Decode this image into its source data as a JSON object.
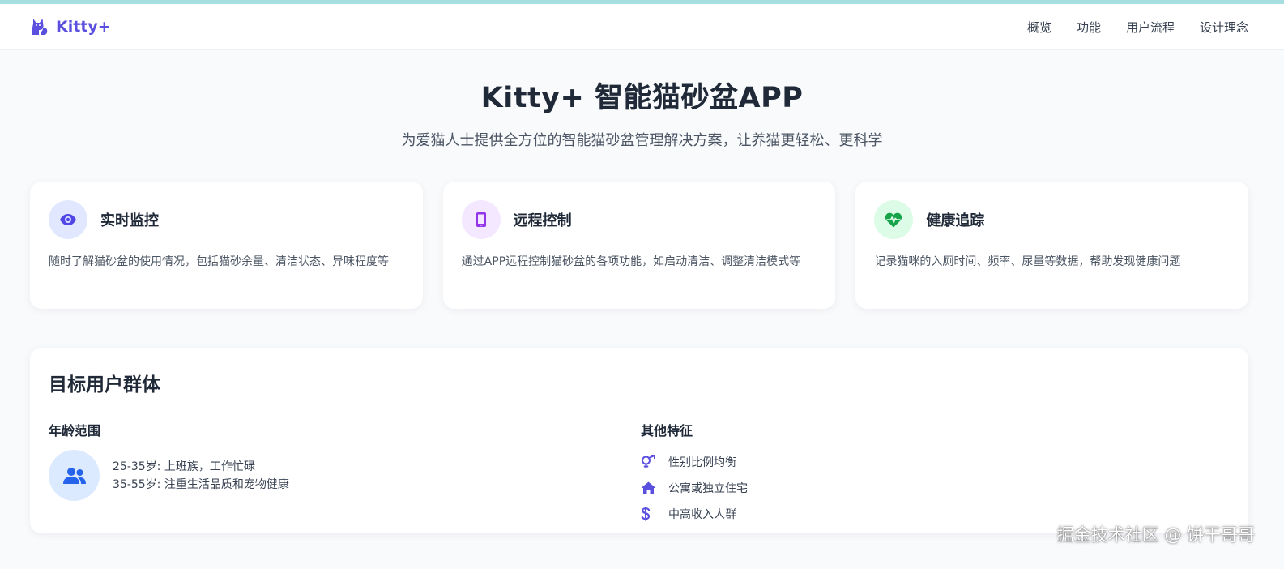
{
  "brand": {
    "name": "Kitty+",
    "logo_icon": "cat-icon",
    "accent": "#5b4fe0"
  },
  "nav": {
    "items": [
      "概览",
      "功能",
      "用户流程",
      "设计理念"
    ]
  },
  "hero": {
    "title": "Kitty+ 智能猫砂盆APP",
    "subtitle": "为爱猫人士提供全方位的智能猫砂盆管理解决方案，让养猫更轻松、更科学"
  },
  "features": [
    {
      "icon": "eye-icon",
      "title": "实时监控",
      "desc": "随时了解猫砂盆的使用情况，包括猫砂余量、清洁状态、异味程度等",
      "color": "#4f46e5"
    },
    {
      "icon": "mobile-icon",
      "title": "远程控制",
      "desc": "通过APP远程控制猫砂盆的各项功能，如启动清洁、调整清洁模式等",
      "color": "#9333ea"
    },
    {
      "icon": "heartbeat-icon",
      "title": "健康追踪",
      "desc": "记录猫咪的入厕时间、频率、尿量等数据，帮助发现健康问题",
      "color": "#16a34a"
    }
  ],
  "audience": {
    "title": "目标用户群体",
    "age": {
      "title": "年龄范围",
      "icon": "users-icon",
      "lines": [
        "25-35岁: 上班族，工作忙碌",
        "35-55岁: 注重生活品质和宠物健康"
      ]
    },
    "traits": {
      "title": "其他特征",
      "items": [
        {
          "icon": "gender-icon",
          "text": "性别比例均衡"
        },
        {
          "icon": "home-icon",
          "text": "公寓或独立住宅"
        },
        {
          "icon": "dollar-icon",
          "text": "中高收入人群"
        }
      ]
    }
  },
  "watermark": "掘金技术社区 @ 饼干哥哥"
}
